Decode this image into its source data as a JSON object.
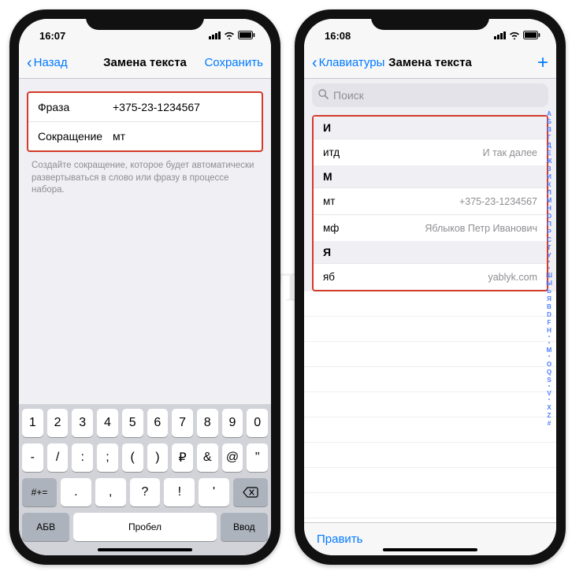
{
  "watermark": "ЯБЛЫК",
  "left": {
    "statusbar_time": "16:07",
    "nav": {
      "back": "Назад",
      "title": "Замена текста",
      "save": "Сохранить"
    },
    "form": {
      "phrase_label": "Фраза",
      "phrase_value": "+375-23-1234567",
      "shortcut_label": "Сокращение",
      "shortcut_value": "мт"
    },
    "footnote": "Создайте сокращение, которое будет автоматически развертываться в слово или фразу в процессе набора.",
    "keyboard": {
      "row1": [
        "1",
        "2",
        "3",
        "4",
        "5",
        "6",
        "7",
        "8",
        "9",
        "0"
      ],
      "row2": [
        "-",
        "/",
        ":",
        ";",
        "(",
        ")",
        "₽",
        "&",
        "@",
        "\""
      ],
      "row3_mode": "#+=",
      "row3": [
        ".",
        ",",
        "?",
        "!",
        "'"
      ],
      "row4_abc": "АБВ",
      "row4_space": "Пробел",
      "row4_return": "Ввод"
    }
  },
  "right": {
    "statusbar_time": "16:08",
    "nav": {
      "back": "Клавиатуры",
      "title": "Замена текста"
    },
    "search_placeholder": "Поиск",
    "sections": [
      {
        "header": "И",
        "rows": [
          {
            "shortcut": "итд",
            "phrase": "И так далее"
          }
        ]
      },
      {
        "header": "М",
        "rows": [
          {
            "shortcut": "мт",
            "phrase": "+375-23-1234567"
          },
          {
            "shortcut": "мф",
            "phrase": "Яблыков Петр Иванович"
          }
        ]
      },
      {
        "header": "Я",
        "rows": [
          {
            "shortcut": "яб",
            "phrase": "yablyk.com"
          }
        ]
      }
    ],
    "index": [
      "А",
      "Б",
      "В",
      "Г",
      "Д",
      "Е",
      "Ж",
      "З",
      "И",
      "К",
      "Л",
      "М",
      "Н",
      "О",
      "П",
      "Р",
      "С",
      "Т",
      "У",
      "•",
      "•",
      "Ш",
      "Ы",
      "Ь",
      "Я",
      "B",
      "D",
      "F",
      "H",
      "•",
      "•",
      "M",
      "•",
      "O",
      "Q",
      "S",
      "•",
      "V",
      "•",
      "X",
      "Z",
      "#"
    ],
    "edit": "Править"
  }
}
